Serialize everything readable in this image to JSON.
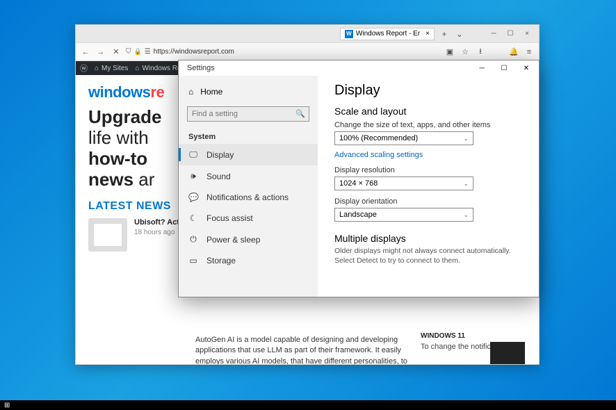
{
  "browser": {
    "tab": {
      "title": "Windows Report - Er",
      "favicon_letter": "W"
    },
    "url": "https://windowsreport.com",
    "wpbar": {
      "mysites": "My Sites",
      "siteitem": "Windows Re"
    }
  },
  "page": {
    "logo_a": "windows",
    "logo_b": "re",
    "hl_b1": "Upgrade",
    "hl_t1": "life with",
    "hl_b2": "how-to",
    "hl_b3": "news",
    "hl_t2": " ar",
    "latest": "LATEST NEWS",
    "news1": {
      "title": "Ubisoft? Activision? Xbox? Who has the streaming rights?",
      "time": "18 hours ago"
    },
    "article": "AutoGen AI is a model capable of designing and developing applications that use LLM as part of their framework. It easily employs various AI models, that have different personalities, to",
    "sidecard": {
      "heading": "Windows 11",
      "desc": "To change the notification"
    }
  },
  "settings": {
    "window_title": "Settings",
    "home": "Home",
    "search_placeholder": "Find a setting",
    "category": "System",
    "items": {
      "display": "Display",
      "sound": "Sound",
      "notifications": "Notifications & actions",
      "focus": "Focus assist",
      "power": "Power & sleep",
      "storage": "Storage"
    },
    "main": {
      "title": "Display",
      "scale_h": "Scale and layout",
      "scale_lbl": "Change the size of text, apps, and other items",
      "scale_val": "100% (Recommended)",
      "adv_link": "Advanced scaling settings",
      "res_lbl": "Display resolution",
      "res_val": "1024 × 768",
      "orient_lbl": "Display orientation",
      "orient_val": "Landscape",
      "multi_h": "Multiple displays",
      "multi_note": "Older displays might not always connect automatically. Select Detect to try to connect to them."
    }
  }
}
